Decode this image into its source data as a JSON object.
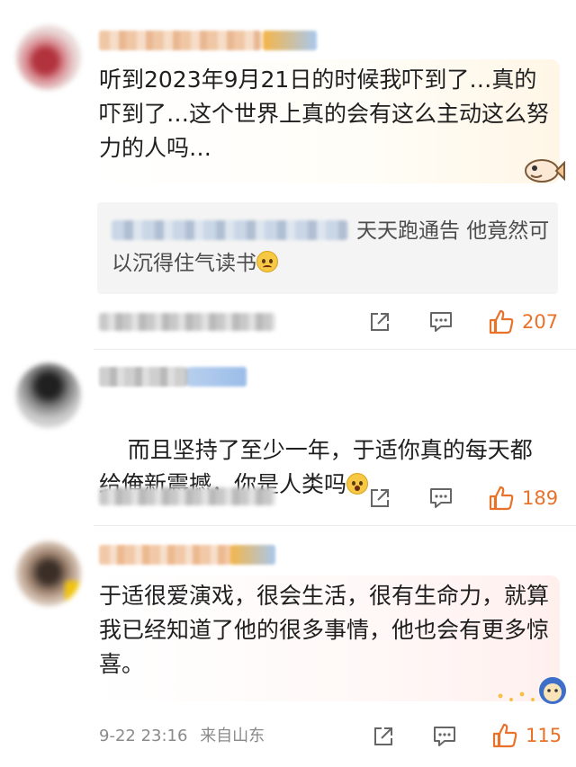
{
  "comments": [
    {
      "text": "听到2023年9月21日的时候我吓到了…真的吓到了…这个世界上真的会有这么主动这么努力的人吗…",
      "quote_text": "天天跑通告 他竟然可以沉得住气读书",
      "quote_emoji": "pleading-face-emoji",
      "sticker": "fish-sticker",
      "likes": "207"
    },
    {
      "text": "而且坚持了至少一年，于适你真的每天都给俺新震撼，你是人类吗",
      "text_emoji": "astonished-face-emoji",
      "likes": "189"
    },
    {
      "text": "于适很爱演戏，很会生活，很有生命力，就算我已经知道了他的很多事情，他也会有更多惊喜。",
      "sticker": "star-sticker",
      "date": "9-22 23:16",
      "location": "来自山东",
      "likes": "115"
    }
  ],
  "colors": {
    "like_accent": "#e9722a",
    "meta_gray": "#8a8a8a",
    "quote_bg": "#f4f4f4"
  }
}
